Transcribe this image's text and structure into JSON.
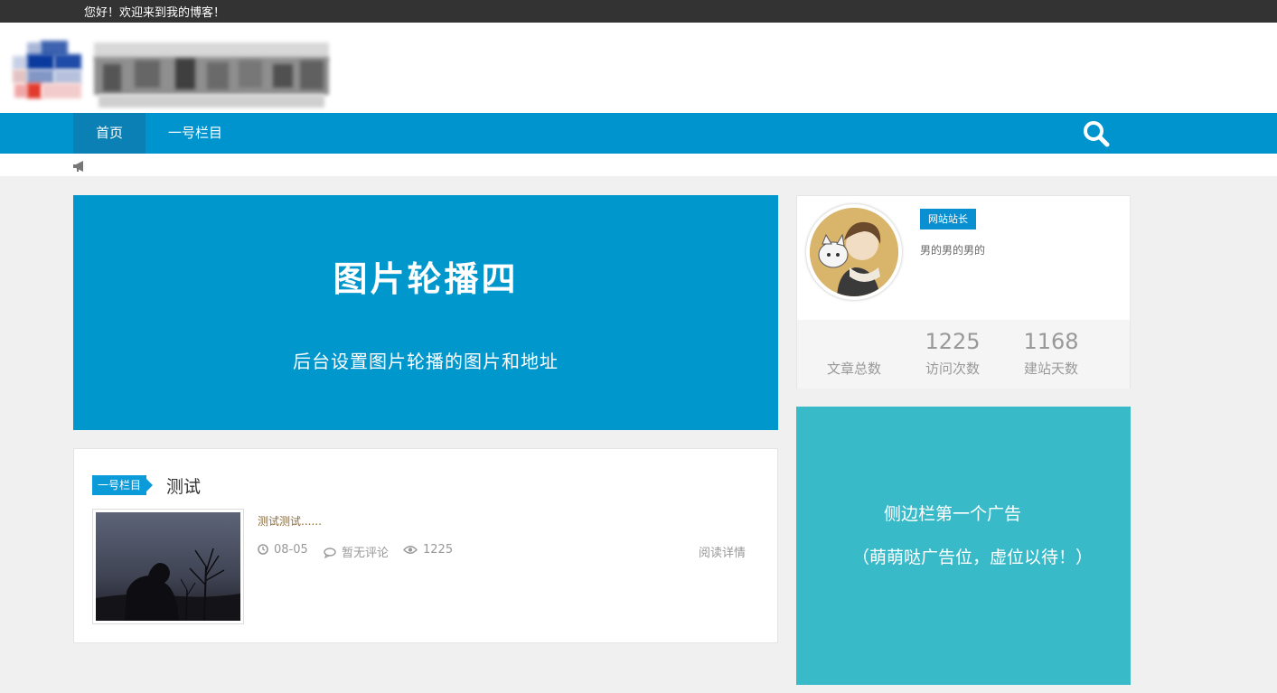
{
  "topbar": {
    "welcome": "您好！欢迎来到我的博客！"
  },
  "nav": {
    "items": [
      {
        "label": "首页",
        "active": true
      },
      {
        "label": "一号栏目",
        "active": false
      }
    ],
    "search_icon": "search-icon",
    "active_color": "#0a80b4",
    "bar_color": "#0094cf"
  },
  "notice": {
    "icon": "megaphone-icon"
  },
  "banner": {
    "title": "图片轮播四",
    "subtitle": "后台设置图片轮播的图片和地址",
    "color": "#0097cc"
  },
  "post": {
    "category": "一号栏目",
    "title": "测试",
    "excerpt": "测试测试......",
    "date": "08-05",
    "comments": "暂无评论",
    "views": "1225",
    "read_more": "阅读详情"
  },
  "profile": {
    "badge": "网站站长",
    "description": "男的男的男的",
    "stats": [
      {
        "value": "",
        "label": "文章总数"
      },
      {
        "value": "1225",
        "label": "访问次数"
      },
      {
        "value": "1168",
        "label": "建站天数"
      }
    ]
  },
  "ad": {
    "line1": "侧边栏第一个广告",
    "line2": "（萌萌哒广告位，虚位以待！）",
    "color": "#39bac9"
  }
}
